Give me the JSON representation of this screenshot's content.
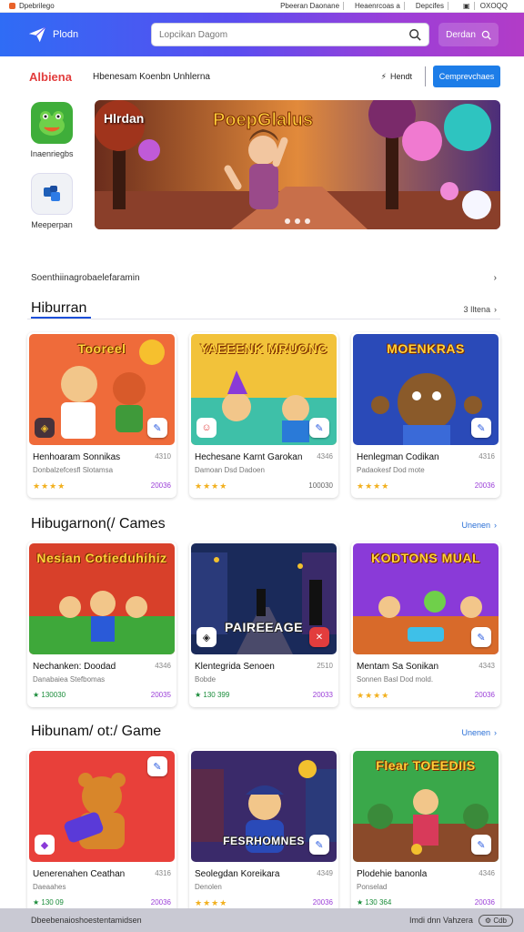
{
  "topbar": {
    "site": "Dpebrilego",
    "links": [
      "Pbeeran Daonane",
      "Heaenrcoas a",
      "Depcifes"
    ],
    "account": "OXOQQ"
  },
  "header": {
    "brand": "Plodn",
    "search_placeholder": "Lopcikan Dagom",
    "search_button": "Derdan"
  },
  "catrow": {
    "app_title": "Albiena",
    "category": "Hbenesam Koenbn Unhlerna",
    "reader_label": "Hendt",
    "cta": "Cemprevchaes"
  },
  "side_apps": [
    {
      "label": "Inaenriegbs"
    },
    {
      "label": "Meeperpan"
    }
  ],
  "banner": {
    "label": "Hlrdan",
    "logo_text": "PoepGlalus"
  },
  "breadcrumb": "Soenthiinagrobaelefaramin",
  "sections": [
    {
      "title": "Hiburran",
      "more": "3 Iltena",
      "cards": [
        {
          "art": "Tooreel",
          "name": "Henhoaram Sonnikas",
          "num": "4310",
          "sub": "Donbalzefcesfl Slotamsa",
          "rating": "★★★★",
          "extra": "20036"
        },
        {
          "art": "YAEEENK MRUONC",
          "name": "Hechesane Karnt Garokan",
          "num": "4346",
          "sub": "Damoan Dsd Dadoen",
          "rating": "★★★★",
          "extra": "100030"
        },
        {
          "art": "MOENKRAS",
          "name": "Henlegman Codikan",
          "num": "4316",
          "sub": "Padaokesf Dod mote",
          "rating": "★★★★",
          "extra": "20036"
        }
      ]
    },
    {
      "title": "Hibugarnon(/ Cames",
      "more": "Unenen",
      "cards": [
        {
          "art": "Nesian Cotieduhihiz",
          "name": "Nechanken: Doodad",
          "num": "4346",
          "sub": "Danabaiea Stefbomas",
          "rating": "★ 130030",
          "extra": "20035"
        },
        {
          "art": "PAIREEAGE",
          "name": "Klentegrida Senoen",
          "num": "2510",
          "sub": "Bobde",
          "rating": "★ 130 399",
          "extra": "20033"
        },
        {
          "art": "KODTONS MUAL",
          "name": "Mentam Sa Sonikan",
          "num": "4343",
          "sub": "Sonnen Basl Dod mold.",
          "rating": "★★★★",
          "extra": "20036"
        }
      ]
    },
    {
      "title": "Hibunam/ ot:/ Game",
      "more": "Unenen",
      "cards": [
        {
          "art": "",
          "name": "Uenerenahen Ceathan",
          "num": "4316",
          "sub": "Daeaahes",
          "rating": "★ 130 09",
          "extra": "20036"
        },
        {
          "art": "FESRHOMNES",
          "name": "Seolegdan Koreikara",
          "num": "4349",
          "sub": "Denolen",
          "rating": "★★★★",
          "extra": "20036"
        },
        {
          "art": "Flear TOEEDIIS",
          "name": "Plodehie banonla",
          "num": "4346",
          "sub": "Ponselad",
          "rating": "★ 130 364",
          "extra": "20036"
        }
      ]
    }
  ],
  "footer": {
    "left": "Dbeebenaioshoestentamidsen",
    "right": "Imdi dnn Vahzera",
    "badge": "Cdb"
  },
  "colors": {
    "accent_blue": "#1d7de8",
    "header_gradient_start": "#2f6cf5",
    "header_gradient_end": "#b23cc7"
  }
}
